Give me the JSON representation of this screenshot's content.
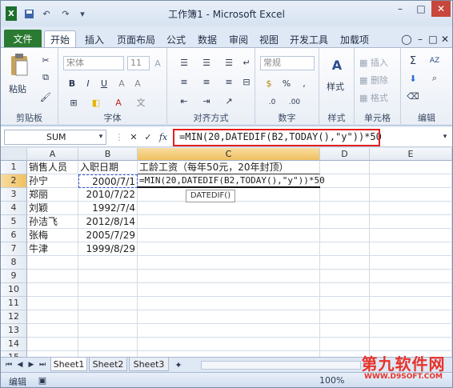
{
  "window": {
    "title": "工作簿1 - Microsoft Excel"
  },
  "quick_access": [
    "save-icon",
    "undo-icon",
    "redo-icon"
  ],
  "tabs": [
    "文件",
    "开始",
    "插入",
    "页面布局",
    "公式",
    "数据",
    "审阅",
    "视图",
    "开发工具",
    "加载项"
  ],
  "ribbon": {
    "clipboard": {
      "label": "剪贴板",
      "paste": "粘贴"
    },
    "font": {
      "label": "字体",
      "font_name": "宋体",
      "font_size": "11",
      "bold": "B",
      "italic": "I",
      "underline": "U"
    },
    "alignment": {
      "label": "对齐方式"
    },
    "number": {
      "label": "数字",
      "format": "常规"
    },
    "styles": {
      "label": "样式",
      "button": "样式"
    },
    "cells": {
      "label": "单元格",
      "insert": "插入",
      "delete": "删除",
      "format": "格式"
    },
    "editing": {
      "label": "编辑",
      "sum": "Σ",
      "sort": "AZ"
    }
  },
  "formula_bar": {
    "name_box": "SUM",
    "formula": "=MIN(20,DATEDIF(B2,TODAY(),\"y\"))*50",
    "fx": "fx"
  },
  "columns": [
    "A",
    "B",
    "C",
    "D",
    "E"
  ],
  "rows": [
    "1",
    "2",
    "3",
    "4",
    "5",
    "6",
    "7",
    "8",
    "9",
    "10",
    "11",
    "12",
    "13",
    "14",
    "15"
  ],
  "cells": {
    "A1": "销售人员",
    "B1": "入职日期",
    "C1": "工龄工资（每年50元，20年封顶）",
    "A2": "孙宁",
    "B2": "2000/7/1",
    "C2": "=MIN(20,DATEDIF(B2,TODAY(),\"y\"))*50",
    "A3": "郑丽",
    "B3": "2010/7/22",
    "A4": "刘颖",
    "B4": "1992/7/4",
    "A5": "孙洁飞",
    "B5": "2012/8/14",
    "A6": "张梅",
    "B6": "2005/7/29",
    "A7": "牛津",
    "B7": "1999/8/29"
  },
  "tooltip": "DATEDIF()",
  "sheets": [
    "Sheet1",
    "Sheet2",
    "Sheet3"
  ],
  "status": {
    "mode": "编辑",
    "zoom": "100%"
  },
  "watermark": {
    "line1": "第九软件网",
    "line2": "WWW.D9SOFT.COM"
  }
}
